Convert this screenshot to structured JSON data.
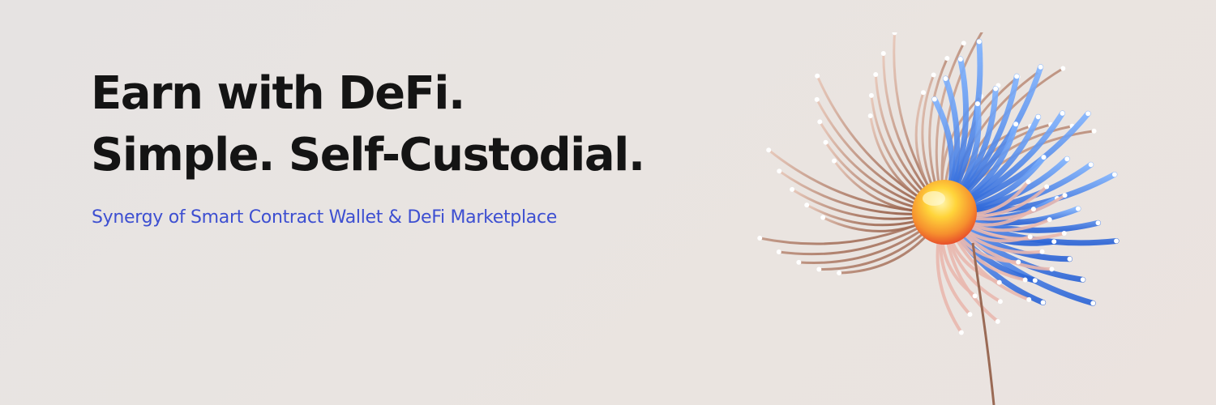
{
  "hero": {
    "headline_line1": "Earn with DeFi.",
    "headline_line2": "Simple. Self-Custodial.",
    "subtitle": "Synergy of Smart Contract Wallet & DeFi Marketplace"
  },
  "colors": {
    "background": "#e8e4e2",
    "headline": "#141414",
    "subtitle": "#3d4fd1",
    "petal_blue": "#3f7fe0",
    "petal_copper": "#b8785c",
    "core_yellow": "#ffd43a",
    "core_orange": "#f0642a"
  },
  "illustration": {
    "icon": "abstract-flower-icon"
  }
}
